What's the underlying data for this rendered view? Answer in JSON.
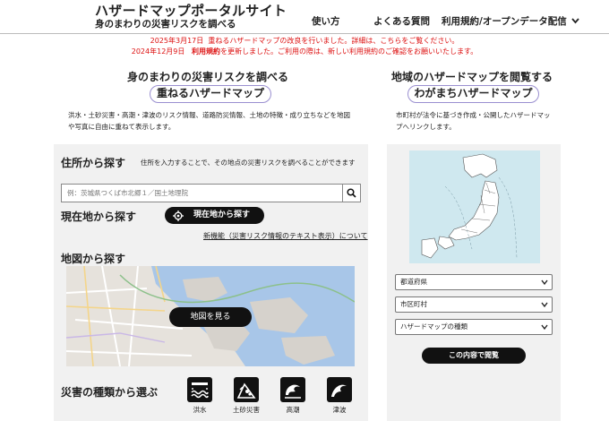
{
  "header": {
    "title": "ハザードマップポータルサイト",
    "subtitle": "身のまわりの災害リスクを調べる",
    "nav": [
      "使い方",
      "よくある質問",
      "利用規約/オープンデータ配信"
    ]
  },
  "notices": [
    {
      "date": "2025年3月17日",
      "text": "重ねるハザードマップの改良を行いました。詳細は、",
      "link": "こちら",
      "after": "をご覧ください。"
    },
    {
      "date": "2024年12月9日",
      "link": "利用規約",
      "text": "を更新しました。ご利用の際は、新しい利用規約のご確認をお願いいたします。"
    }
  ],
  "left": {
    "heading": "身のまわりの災害リスクを調べる",
    "pill": "重ねるハザードマップ",
    "description": "洪水・土砂災害・高潮・津波のリスク情報、道路防災情報、土地の特徴・成り立ちなどを地図や写真に自由に重ねて表示します。"
  },
  "right": {
    "heading": "地域のハザードマップを閲覧する",
    "pill": "わがまちハザードマップ",
    "description": "市町村が法令に基づき作成・公開したハザードマップへリンクします。"
  },
  "address": {
    "title": "住所から探す",
    "note": "住所を入力することで、その地点の災害リスクを調べることができます",
    "placeholder": "例：茨城県つくば市北郷１／国土地理院"
  },
  "current": {
    "title": "現在地から探す",
    "button": "現在地から探す",
    "newfunc": "新機能（災害リスク情報のテキスト表示）について"
  },
  "mapsearch": {
    "title": "地図から探す",
    "button": "地図を見る"
  },
  "disaster": {
    "title": "災害の種類から選ぶ",
    "types": [
      {
        "label": "洪水",
        "icon": "flood-icon"
      },
      {
        "label": "土砂災害",
        "icon": "landslide-icon"
      },
      {
        "label": "高潮",
        "icon": "storm-surge-icon"
      },
      {
        "label": "津波",
        "icon": "tsunami-icon"
      }
    ]
  },
  "wagamachi": {
    "selects": [
      "都道府県",
      "市区町村",
      "ハザードマップの種類"
    ],
    "button": "この内容で閲覧"
  }
}
